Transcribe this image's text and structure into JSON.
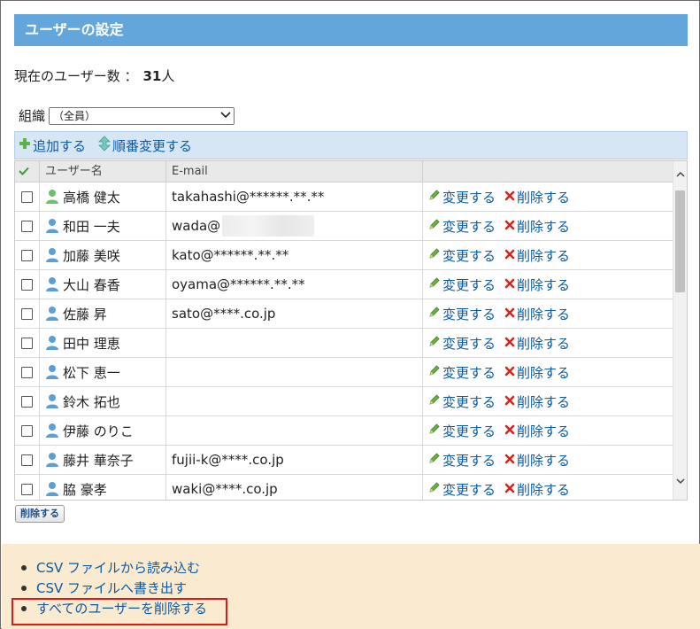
{
  "page": {
    "title": "ユーザーの設定"
  },
  "user_count": {
    "label": "現在のユーザー数 ：",
    "value": "31",
    "unit": "人"
  },
  "org": {
    "label": "組織",
    "selected": "（全員）"
  },
  "toolbar": {
    "add_label": "追加する",
    "reorder_label": "順番変更する"
  },
  "table": {
    "headers": {
      "name": "ユーザー名",
      "email": "E-mail"
    },
    "actions": {
      "edit_label": "変更する",
      "delete_label": "削除する"
    },
    "rows": [
      {
        "name": "高橋 健太",
        "email": "takahashi@******.**.**",
        "icon_color": "#6cc06c"
      },
      {
        "name": "和田 一夫",
        "email": "wada@",
        "icon_color": "#5a9fd6",
        "blurred": true
      },
      {
        "name": "加藤 美咲",
        "email": "kato@******.**.**",
        "icon_color": "#5a9fd6"
      },
      {
        "name": "大山 春香",
        "email": "oyama@******.**.**",
        "icon_color": "#5a9fd6"
      },
      {
        "name": "佐藤 昇",
        "email": "sato@****.co.jp",
        "icon_color": "#5a9fd6"
      },
      {
        "name": "田中 理恵",
        "email": "",
        "icon_color": "#5a9fd6"
      },
      {
        "name": "松下 恵一",
        "email": "",
        "icon_color": "#5a9fd6"
      },
      {
        "name": "鈴木 拓也",
        "email": "",
        "icon_color": "#5a9fd6"
      },
      {
        "name": "伊藤 のりこ",
        "email": "",
        "icon_color": "#5a9fd6"
      },
      {
        "name": "藤井 華奈子",
        "email": "fujii-k@****.co.jp",
        "icon_color": "#5a9fd6"
      },
      {
        "name": "脇 豪孝",
        "email": "waki@****.co.jp",
        "icon_color": "#5a9fd6"
      }
    ]
  },
  "delete_button": {
    "label": "削除する"
  },
  "footer": {
    "links": [
      {
        "label": "CSV ファイルから読み込む"
      },
      {
        "label": "CSV ファイルへ書き出す"
      },
      {
        "label": "すべてのユーザーを削除する"
      }
    ]
  },
  "colors": {
    "title_bar": "#62a6dc",
    "link": "#0b5aa6",
    "footer_bg": "#f9ead0",
    "highlight": "#e01818"
  }
}
